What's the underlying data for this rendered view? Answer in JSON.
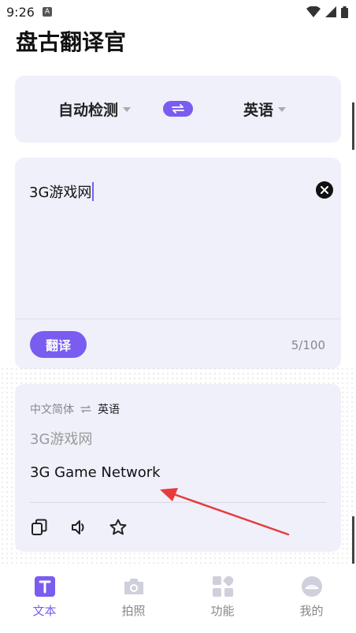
{
  "status": {
    "time": "9:26",
    "badge": "A"
  },
  "app": {
    "title": "盘古翻译官"
  },
  "lang_bar": {
    "source": "自动检测",
    "target": "英语"
  },
  "input": {
    "text": "3G游戏网",
    "translate_label": "翻译",
    "count": "5/100"
  },
  "result": {
    "source_lang": "中文简体",
    "target_lang": "英语",
    "source_text": "3G游戏网",
    "translated_text": "3G Game Network"
  },
  "nav": [
    {
      "label": "文本",
      "icon": "text-icon"
    },
    {
      "label": "拍照",
      "icon": "camera-icon"
    },
    {
      "label": "功能",
      "icon": "apps-icon"
    },
    {
      "label": "我的",
      "icon": "profile-icon"
    }
  ],
  "colors": {
    "accent": "#7a5cf0",
    "card": "#eff0fa",
    "annotation": "#e83a3a"
  }
}
